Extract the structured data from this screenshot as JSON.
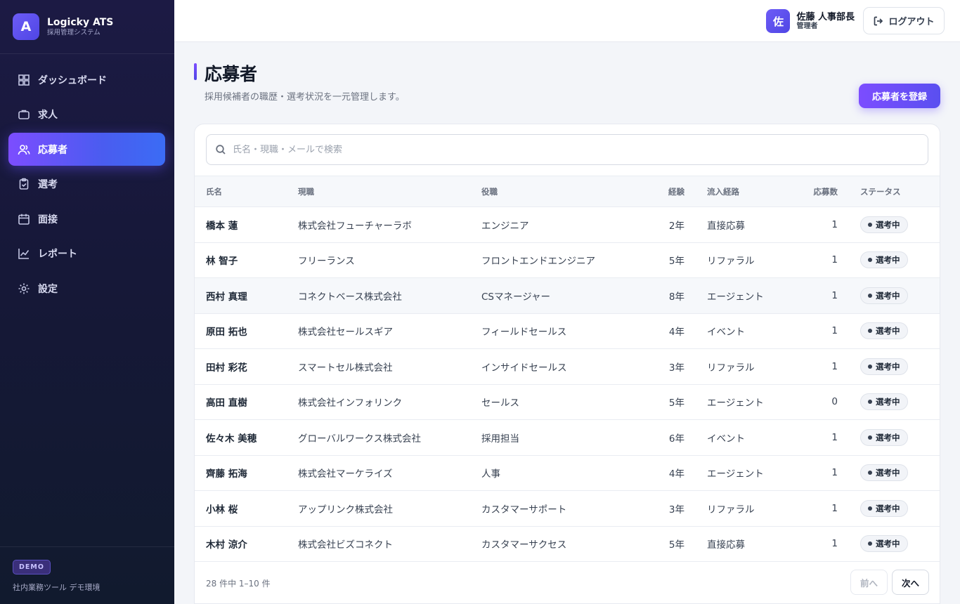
{
  "brand": {
    "logo_letter": "A",
    "name": "Logicky ATS",
    "subtitle": "採用管理システム"
  },
  "sidebar": {
    "items": [
      {
        "label": "ダッシュボード",
        "icon": "dashboard-icon",
        "active": false
      },
      {
        "label": "求人",
        "icon": "briefcase-icon",
        "active": false
      },
      {
        "label": "応募者",
        "icon": "users-icon",
        "active": true
      },
      {
        "label": "選考",
        "icon": "clipboard-icon",
        "active": false
      },
      {
        "label": "面接",
        "icon": "calendar-icon",
        "active": false
      },
      {
        "label": "レポート",
        "icon": "chart-icon",
        "active": false
      },
      {
        "label": "設定",
        "icon": "gear-icon",
        "active": false
      }
    ],
    "footer": {
      "badge": "DEMO",
      "text": "社内業務ツール デモ環境"
    }
  },
  "topbar": {
    "avatar_letter": "佐",
    "user_name": "佐藤 人事部長",
    "user_role": "管理者",
    "logout_label": "ログアウト"
  },
  "page": {
    "title": "応募者",
    "subtitle": "採用候補者の職歴・選考状況を一元管理します。",
    "primary_action": "応募者を登録"
  },
  "search": {
    "placeholder": "氏名・現職・メールで検索",
    "value": ""
  },
  "table": {
    "headers": {
      "name": "氏名",
      "current": "現職",
      "role": "役職",
      "exp": "経験",
      "source": "流入経路",
      "apps": "応募数",
      "status": "ステータス"
    },
    "rows": [
      {
        "name": "橋本 蓮",
        "current": "株式会社フューチャーラボ",
        "role": "エンジニア",
        "exp": "2年",
        "source": "直接応募",
        "apps": "1",
        "status": "選考中"
      },
      {
        "name": "林 智子",
        "current": "フリーランス",
        "role": "フロントエンドエンジニア",
        "exp": "5年",
        "source": "リファラル",
        "apps": "1",
        "status": "選考中"
      },
      {
        "name": "西村 真理",
        "current": "コネクトベース株式会社",
        "role": "CSマネージャー",
        "exp": "8年",
        "source": "エージェント",
        "apps": "1",
        "status": "選考中"
      },
      {
        "name": "原田 拓也",
        "current": "株式会社セールスギア",
        "role": "フィールドセールス",
        "exp": "4年",
        "source": "イベント",
        "apps": "1",
        "status": "選考中"
      },
      {
        "name": "田村 彩花",
        "current": "スマートセル株式会社",
        "role": "インサイドセールス",
        "exp": "3年",
        "source": "リファラル",
        "apps": "1",
        "status": "選考中"
      },
      {
        "name": "高田 直樹",
        "current": "株式会社インフォリンク",
        "role": "セールス",
        "exp": "5年",
        "source": "エージェント",
        "apps": "0",
        "status": "選考中"
      },
      {
        "name": "佐々木 美穂",
        "current": "グローバルワークス株式会社",
        "role": "採用担当",
        "exp": "6年",
        "source": "イベント",
        "apps": "1",
        "status": "選考中"
      },
      {
        "name": "齊藤 拓海",
        "current": "株式会社マーケライズ",
        "role": "人事",
        "exp": "4年",
        "source": "エージェント",
        "apps": "1",
        "status": "選考中"
      },
      {
        "name": "小林 桜",
        "current": "アップリンク株式会社",
        "role": "カスタマーサポート",
        "exp": "3年",
        "source": "リファラル",
        "apps": "1",
        "status": "選考中"
      },
      {
        "name": "木村 涼介",
        "current": "株式会社ビズコネクト",
        "role": "カスタマーサクセス",
        "exp": "5年",
        "source": "直接応募",
        "apps": "1",
        "status": "選考中"
      }
    ]
  },
  "pagination": {
    "summary": "28 件中 1–10 件",
    "prev": "前へ",
    "next": "次へ"
  },
  "colors": {
    "accent": "#6d4dff",
    "sidebar_bg": "#1c1a44",
    "page_bg": "#f3f5f9"
  }
}
